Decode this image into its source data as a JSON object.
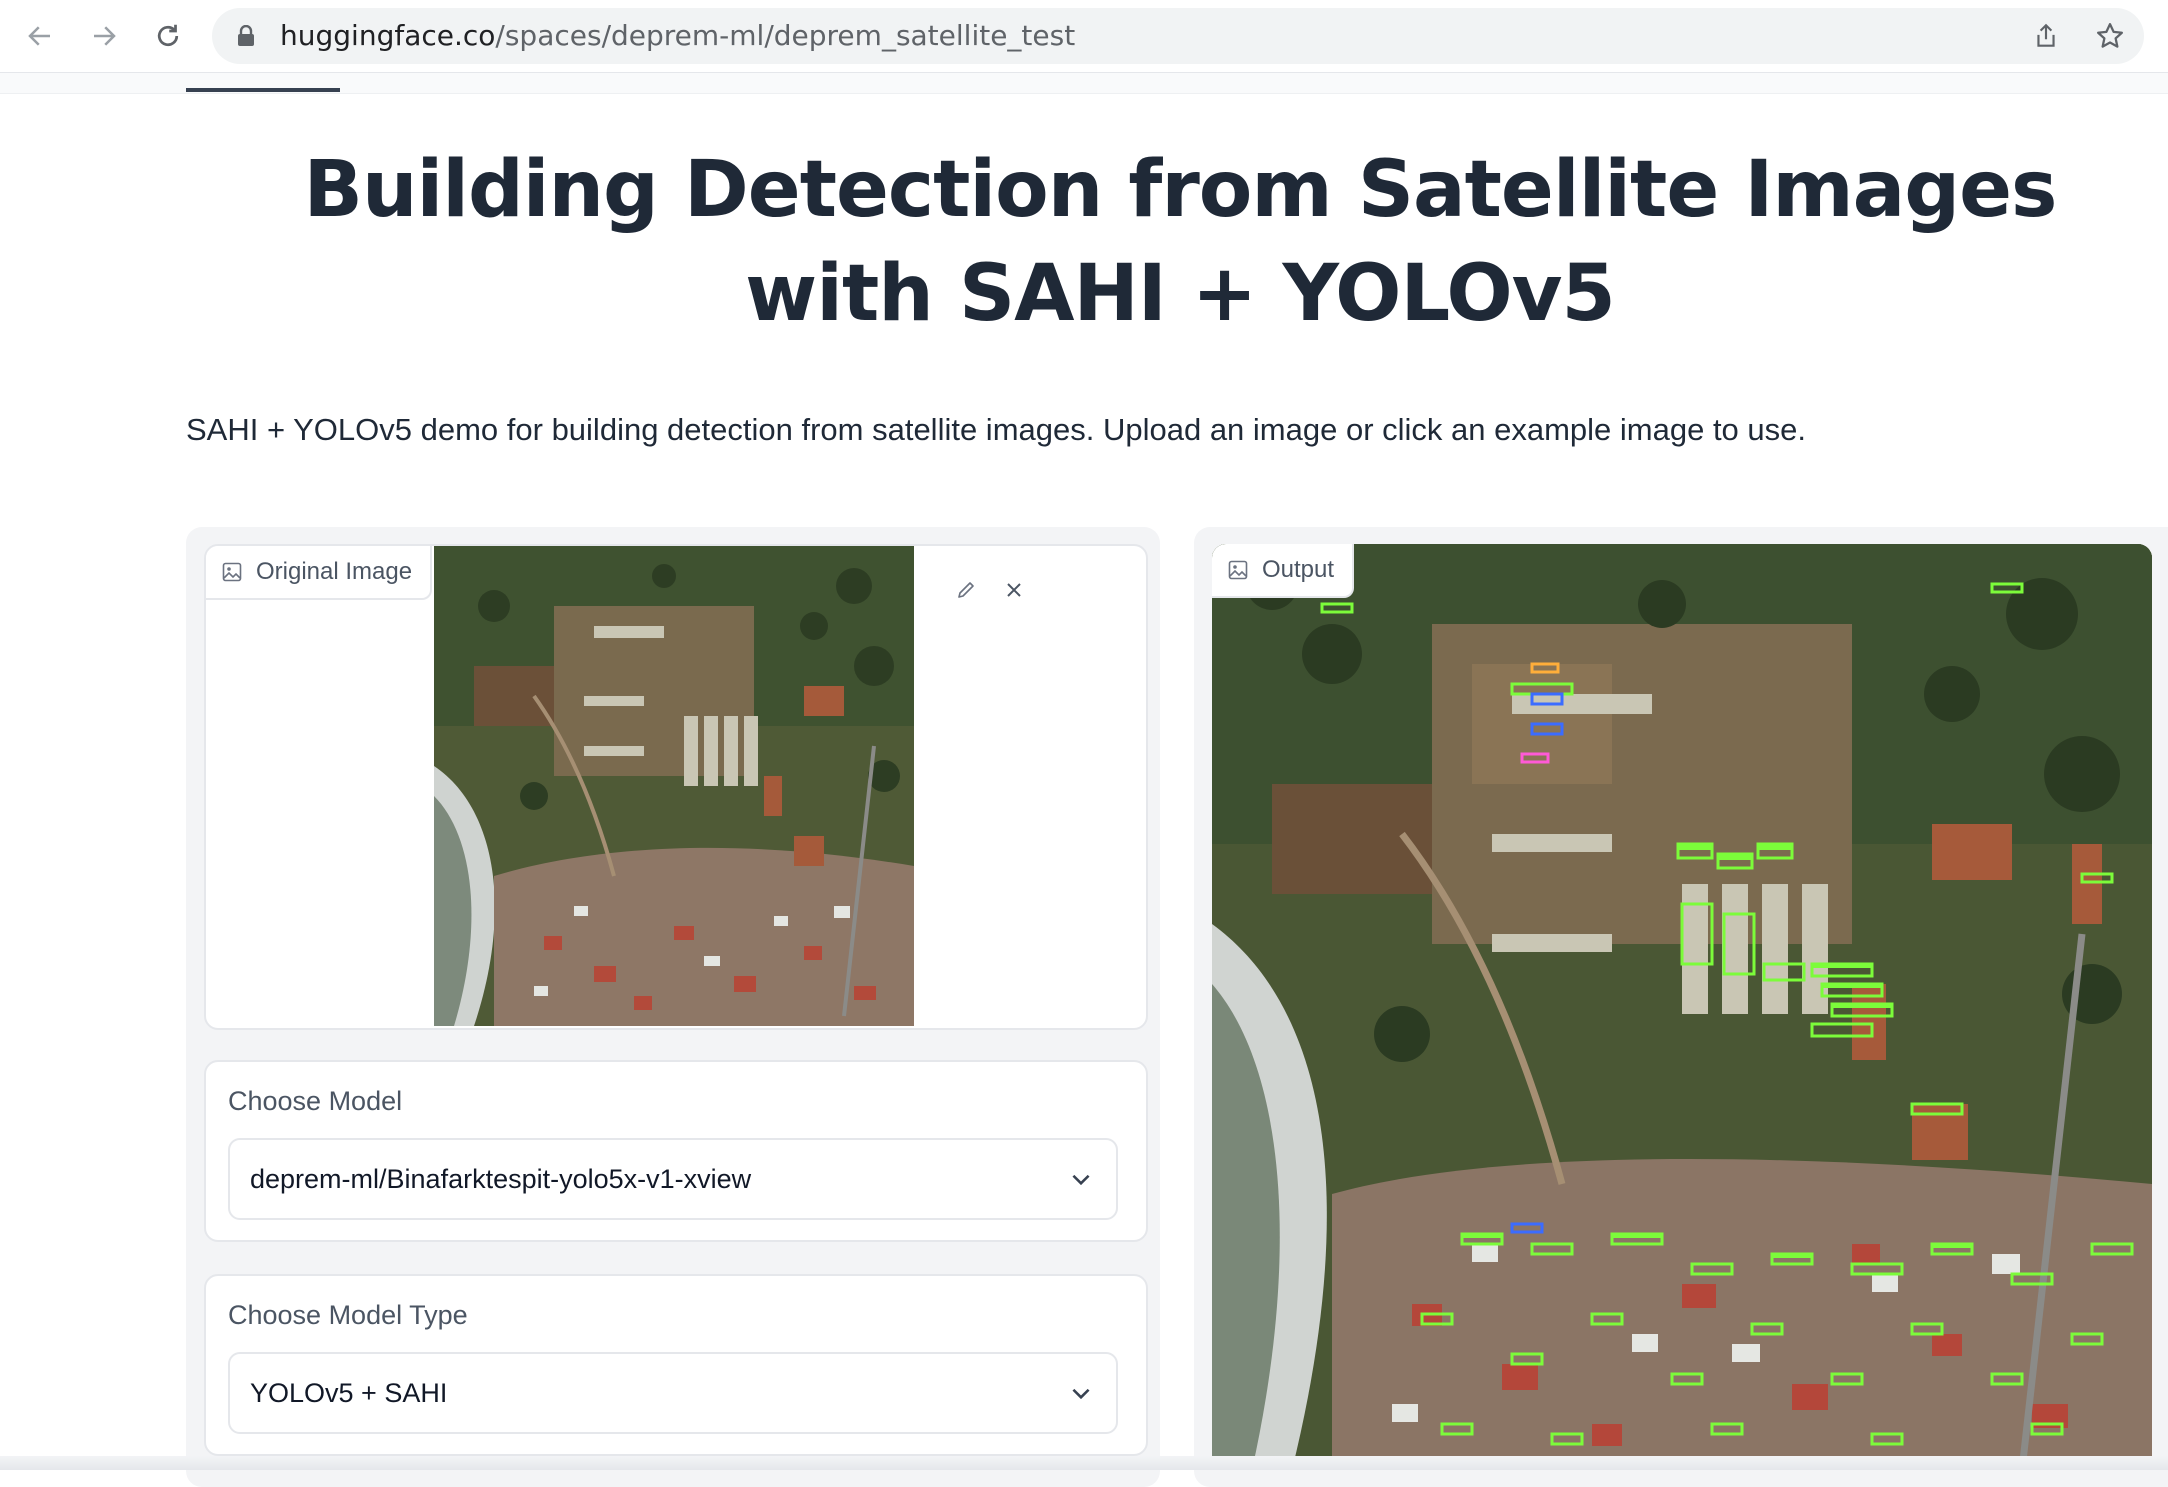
{
  "browser": {
    "url_host": "huggingface.co",
    "url_path": "/spaces/deprem-ml/deprem_satellite_test"
  },
  "page": {
    "title": "Building Detection from Satellite Images with SAHI + YOLOv5",
    "description": "SAHI + YOLOv5 demo for building detection from satellite images. Upload an image or click an example image to use."
  },
  "input_image": {
    "label": "Original Image"
  },
  "model_select": {
    "label": "Choose Model",
    "value": "deprem-ml/Binafarktespit-yolo5x-v1-xview"
  },
  "model_type_select": {
    "label": "Choose Model Type",
    "value": "YOLOv5 + SAHI"
  },
  "output_image": {
    "label": "Output"
  },
  "colors": {
    "detection_box": "#7cfc3a",
    "panel_bg": "#f3f4f6",
    "title_text": "#1f2937"
  }
}
